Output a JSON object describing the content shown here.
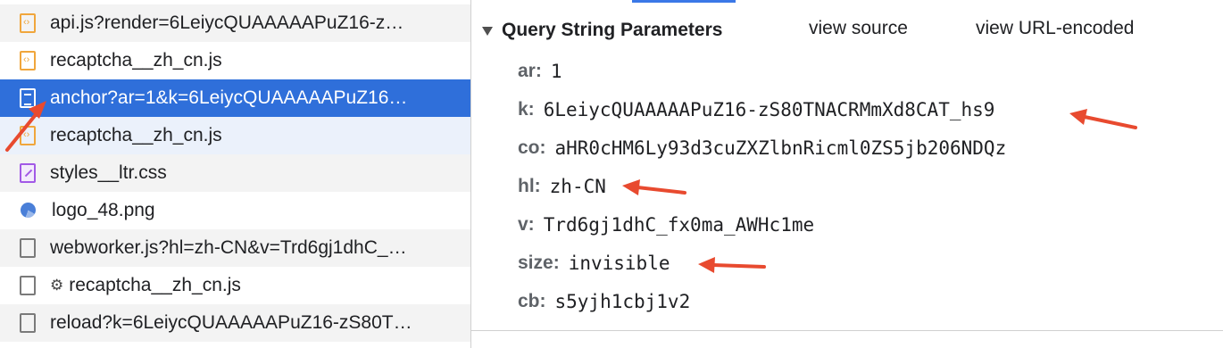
{
  "requests": [
    {
      "name": "api.js?render=6LeiycQUAAAAAPuZ16-z…",
      "icon": "script-file-icon"
    },
    {
      "name": "recaptcha__zh_cn.js",
      "icon": "script-file-icon"
    },
    {
      "name": "anchor?ar=1&k=6LeiycQUAAAAAPuZ16…",
      "icon": "document-icon",
      "selected": true
    },
    {
      "name": "recaptcha__zh_cn.js",
      "icon": "script-file-icon"
    },
    {
      "name": "styles__ltr.css",
      "icon": "stylesheet-icon"
    },
    {
      "name": "logo_48.png",
      "icon": "image-icon"
    },
    {
      "name": "webworker.js?hl=zh-CN&v=Trd6gj1dhC_…",
      "icon": "blank-file-icon"
    },
    {
      "name": "recaptcha__zh_cn.js",
      "icon": "blank-file-icon",
      "prefix_icon": "gear-icon"
    },
    {
      "name": "reload?k=6LeiycQUAAAAAPuZ16-zS80T…",
      "icon": "blank-file-icon"
    }
  ],
  "query_params": {
    "title": "Query String Parameters",
    "view_source": "view source",
    "view_url_encoded": "view URL-encoded",
    "items": [
      {
        "key": "ar:",
        "value": "1"
      },
      {
        "key": "k:",
        "value": "6LeiycQUAAAAAPuZ16-zS80TNACRMmXd8CAT_hs9"
      },
      {
        "key": "co:",
        "value": "aHR0cHM6Ly93d3cuZXZlbnRicml0ZS5jb206NDQz"
      },
      {
        "key": "hl:",
        "value": "zh-CN"
      },
      {
        "key": "v:",
        "value": "Trd6gj1dhC_fx0ma_AWHc1me"
      },
      {
        "key": "size:",
        "value": "invisible"
      },
      {
        "key": "cb:",
        "value": "s5yjh1cbj1v2"
      }
    ]
  },
  "annotation_color": "#e84a2f"
}
